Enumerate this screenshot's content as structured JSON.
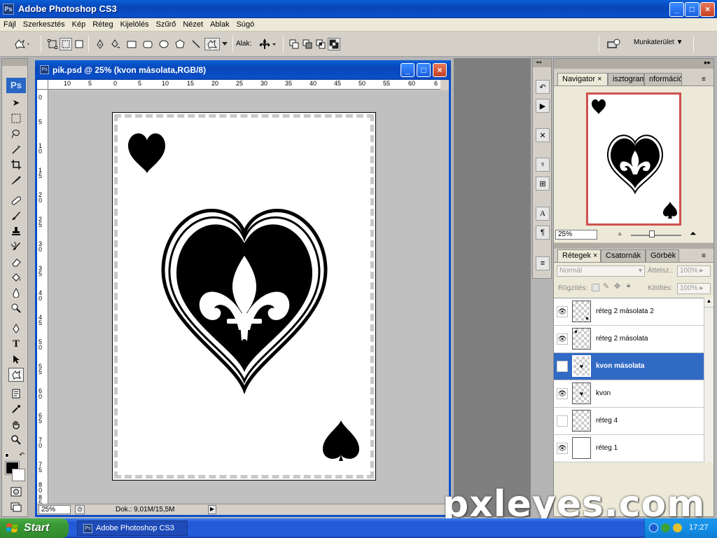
{
  "window": {
    "title": "Adobe Photoshop CS3",
    "logo": "Ps",
    "minimize_label": "_",
    "maximize_label": "□",
    "close_label": "×"
  },
  "menu": [
    "Fájl",
    "Szerkesztés",
    "Kép",
    "Réteg",
    "Kijelölés",
    "Szűrő",
    "Nézet",
    "Ablak",
    "Súgó"
  ],
  "options_bar": {
    "shape_label": "Alak:",
    "workspace_label": "Munkaterület"
  },
  "toolbox": {
    "logo": "Ps"
  },
  "document": {
    "title": "pik.psd @ 25% (kvon másolata,RGB/8)",
    "icon": "Ps",
    "ruler_top": [
      "10",
      "5",
      "0",
      "5",
      "10",
      "15",
      "20",
      "25",
      "30",
      "35",
      "40",
      "45",
      "50",
      "55",
      "60",
      "6"
    ],
    "ruler_left": [
      "0",
      "5",
      "1 0",
      "1 5",
      "2 0",
      "2 5",
      "3 0",
      "3 5",
      "4 0",
      "4 5",
      "5 0",
      "5 5",
      "6 0",
      "6 5",
      "7 0",
      "7 5",
      "8 0",
      "8 5"
    ],
    "zoom": "25%",
    "status": "Dok.: 9,01M/15,5M"
  },
  "navigator": {
    "tabs": [
      "Navigator",
      "isztogram",
      "nformáció"
    ],
    "zoom": "25%"
  },
  "layers_panel": {
    "tabs": [
      "Rétegek",
      "Csatornák",
      "Görbék"
    ],
    "blend_mode": "Normál",
    "opacity_label": "Áttetsz.:",
    "opacity_value": "100%",
    "lock_label": "Rögzítés:",
    "fill_label": "Kitöltés:",
    "fill_value": "100%",
    "layers": [
      {
        "name": "réteg 2 másolata 2",
        "visible": true,
        "selected": false
      },
      {
        "name": "réteg 2 másolata",
        "visible": true,
        "selected": false
      },
      {
        "name": "kvon másolata",
        "visible": false,
        "selected": true
      },
      {
        "name": "kvon",
        "visible": true,
        "selected": false
      },
      {
        "name": "réteg 4",
        "visible": false,
        "selected": false
      },
      {
        "name": "réteg 1",
        "visible": true,
        "selected": false
      }
    ]
  },
  "watermark": "pxleyes.com",
  "taskbar": {
    "start_label": "Start",
    "task_label": "Adobe Photoshop CS3",
    "task_icon": "Ps",
    "clock": "17:27"
  },
  "colors": {
    "xp_blue": "#0a4fc9",
    "selection": "#316ac5",
    "navigator_frame": "#d05050",
    "start_green": "#3a9a36"
  }
}
